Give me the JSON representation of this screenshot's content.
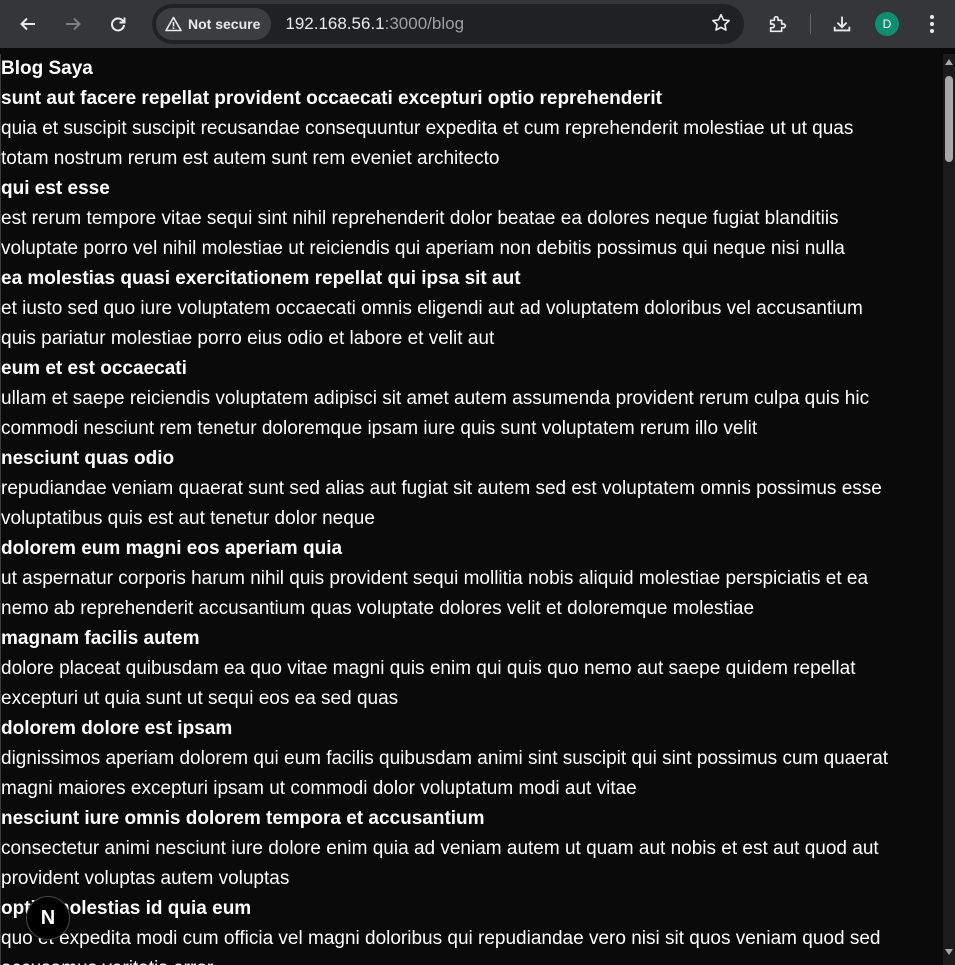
{
  "browser": {
    "security_label": "Not secure",
    "url_host": "192.168.56.1",
    "url_rest": ":3000/blog",
    "profile_initial": "D"
  },
  "page": {
    "title": "Blog Saya",
    "posts": [
      {
        "title": "sunt aut facere repellat provident occaecati excepturi optio reprehenderit",
        "body": [
          "quia et suscipit suscipit recusandae consequuntur expedita et cum reprehenderit molestiae ut ut quas",
          "totam nostrum rerum est autem sunt rem eveniet architecto"
        ]
      },
      {
        "title": "qui est esse",
        "body": [
          "est rerum tempore vitae sequi sint nihil reprehenderit dolor beatae ea dolores neque fugiat blanditiis",
          "voluptate porro vel nihil molestiae ut reiciendis qui aperiam non debitis possimus qui neque nisi nulla"
        ]
      },
      {
        "title": "ea molestias quasi exercitationem repellat qui ipsa sit aut",
        "body": [
          "et iusto sed quo iure voluptatem occaecati omnis eligendi aut ad voluptatem doloribus vel accusantium",
          "quis pariatur molestiae porro eius odio et labore et velit aut"
        ]
      },
      {
        "title": "eum et est occaecati",
        "body": [
          "ullam et saepe reiciendis voluptatem adipisci sit amet autem assumenda provident rerum culpa quis hic",
          "commodi nesciunt rem tenetur doloremque ipsam iure quis sunt voluptatem rerum illo velit"
        ]
      },
      {
        "title": "nesciunt quas odio",
        "body": [
          "repudiandae veniam quaerat sunt sed alias aut fugiat sit autem sed est voluptatem omnis possimus esse",
          "voluptatibus quis est aut tenetur dolor neque"
        ]
      },
      {
        "title": "dolorem eum magni eos aperiam quia",
        "body": [
          "ut aspernatur corporis harum nihil quis provident sequi mollitia nobis aliquid molestiae perspiciatis et ea",
          "nemo ab reprehenderit accusantium quas voluptate dolores velit et doloremque molestiae"
        ]
      },
      {
        "title": "magnam facilis autem",
        "body": [
          "dolore placeat quibusdam ea quo vitae magni quis enim qui quis quo nemo aut saepe quidem repellat",
          "excepturi ut quia sunt ut sequi eos ea sed quas"
        ]
      },
      {
        "title": "dolorem dolore est ipsam",
        "body": [
          "dignissimos aperiam dolorem qui eum facilis quibusdam animi sint suscipit qui sint possimus cum quaerat",
          "magni maiores excepturi ipsam ut commodi dolor voluptatum modi aut vitae"
        ]
      },
      {
        "title": "nesciunt iure omnis dolorem tempora et accusantium",
        "body": [
          "consectetur animi nesciunt iure dolore enim quia ad veniam autem ut quam aut nobis et est aut quod aut",
          "provident voluptas autem voluptas"
        ]
      },
      {
        "title": "optio molestias id quia eum",
        "body": [
          "quo et expedita modi cum officia vel magni doloribus qui repudiandae vero nisi sit quos veniam quod sed",
          "accusamus veritatis error"
        ]
      }
    ]
  },
  "overlay": {
    "badge_letter": "N"
  }
}
